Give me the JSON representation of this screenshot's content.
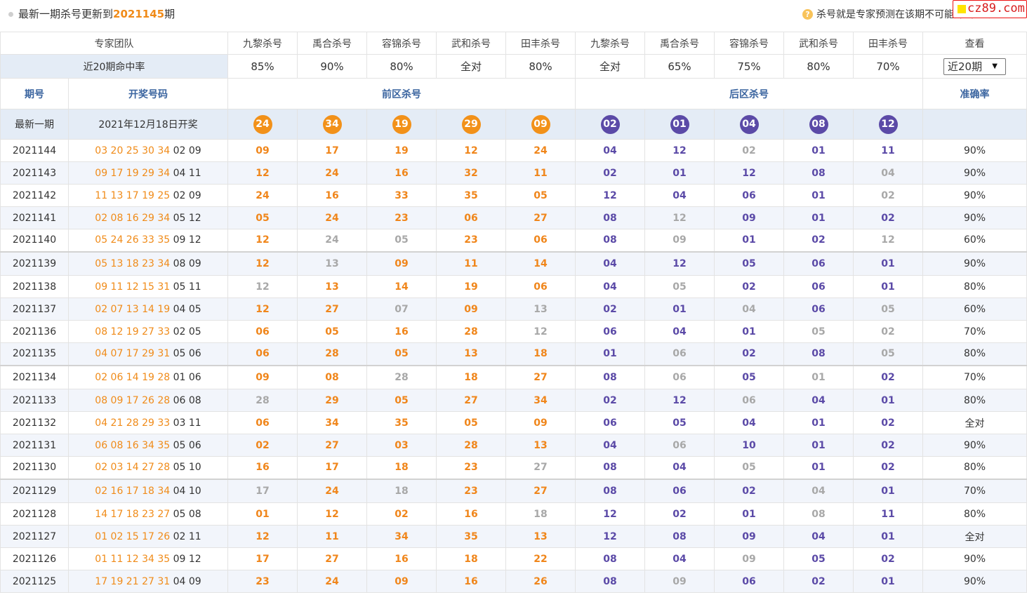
{
  "header": {
    "prefix": "最新一期杀号更新到",
    "issue": "2021145",
    "suffix": "期",
    "help_text": "杀号就是专家预测在该期不可能开出的号码",
    "logo_text": "cz89.com"
  },
  "team_row": {
    "label": "专家团队",
    "experts": [
      "九黎杀号",
      "禹合杀号",
      "容锦杀号",
      "武和杀号",
      "田丰杀号",
      "九黎杀号",
      "禹合杀号",
      "容锦杀号",
      "武和杀号",
      "田丰杀号"
    ],
    "view_label": "查看"
  },
  "rate_row": {
    "label": "近20期命中率",
    "rates": [
      "85%",
      "90%",
      "80%",
      "全对",
      "80%",
      "全对",
      "65%",
      "75%",
      "80%",
      "70%"
    ],
    "period_select": {
      "selected": "近20期",
      "arrow": "▼"
    }
  },
  "sections": {
    "issue": "期号",
    "draw": "开奖号码",
    "front": "前区杀号",
    "back": "后区杀号",
    "accuracy": "准确率"
  },
  "latest": {
    "label": "最新一期",
    "date": "2021年12月18日开奖",
    "front": [
      "24",
      "34",
      "19",
      "29",
      "09"
    ],
    "back": [
      "02",
      "01",
      "04",
      "08",
      "12"
    ]
  },
  "rows": [
    {
      "issue": "2021144",
      "draw_front": "03 20 25 30 34",
      "draw_back": "02 09",
      "front": [
        [
          "09",
          1
        ],
        [
          "17",
          1
        ],
        [
          "19",
          1
        ],
        [
          "12",
          1
        ],
        [
          "24",
          1
        ]
      ],
      "back": [
        [
          "04",
          1
        ],
        [
          "12",
          1
        ],
        [
          "02",
          0
        ],
        [
          "01",
          1
        ],
        [
          "11",
          1
        ]
      ],
      "accuracy": "90%"
    },
    {
      "issue": "2021143",
      "draw_front": "09 17 19 29 34",
      "draw_back": "04 11",
      "front": [
        [
          "12",
          1
        ],
        [
          "24",
          1
        ],
        [
          "16",
          1
        ],
        [
          "32",
          1
        ],
        [
          "11",
          1
        ]
      ],
      "back": [
        [
          "02",
          1
        ],
        [
          "01",
          1
        ],
        [
          "12",
          1
        ],
        [
          "08",
          1
        ],
        [
          "04",
          0
        ]
      ],
      "accuracy": "90%"
    },
    {
      "issue": "2021142",
      "draw_front": "11 13 17 19 25",
      "draw_back": "02 09",
      "front": [
        [
          "24",
          1
        ],
        [
          "16",
          1
        ],
        [
          "33",
          1
        ],
        [
          "35",
          1
        ],
        [
          "05",
          1
        ]
      ],
      "back": [
        [
          "12",
          1
        ],
        [
          "04",
          1
        ],
        [
          "06",
          1
        ],
        [
          "01",
          1
        ],
        [
          "02",
          0
        ]
      ],
      "accuracy": "90%"
    },
    {
      "issue": "2021141",
      "draw_front": "02 08 16 29 34",
      "draw_back": "05 12",
      "front": [
        [
          "05",
          1
        ],
        [
          "24",
          1
        ],
        [
          "23",
          1
        ],
        [
          "06",
          1
        ],
        [
          "27",
          1
        ]
      ],
      "back": [
        [
          "08",
          1
        ],
        [
          "12",
          0
        ],
        [
          "09",
          1
        ],
        [
          "01",
          1
        ],
        [
          "02",
          1
        ]
      ],
      "accuracy": "90%"
    },
    {
      "issue": "2021140",
      "draw_front": "05 24 26 33 35",
      "draw_back": "09 12",
      "front": [
        [
          "12",
          1
        ],
        [
          "24",
          0
        ],
        [
          "05",
          0
        ],
        [
          "23",
          1
        ],
        [
          "06",
          1
        ]
      ],
      "back": [
        [
          "08",
          1
        ],
        [
          "09",
          0
        ],
        [
          "01",
          1
        ],
        [
          "02",
          1
        ],
        [
          "12",
          0
        ]
      ],
      "accuracy": "60%"
    },
    {
      "issue": "2021139",
      "draw_front": "05 13 18 23 34",
      "draw_back": "08 09",
      "front": [
        [
          "12",
          1
        ],
        [
          "13",
          0
        ],
        [
          "09",
          1
        ],
        [
          "11",
          1
        ],
        [
          "14",
          1
        ]
      ],
      "back": [
        [
          "04",
          1
        ],
        [
          "12",
          1
        ],
        [
          "05",
          1
        ],
        [
          "06",
          1
        ],
        [
          "01",
          1
        ]
      ],
      "accuracy": "90%"
    },
    {
      "issue": "2021138",
      "draw_front": "09 11 12 15 31",
      "draw_back": "05 11",
      "front": [
        [
          "12",
          0
        ],
        [
          "13",
          1
        ],
        [
          "14",
          1
        ],
        [
          "19",
          1
        ],
        [
          "06",
          1
        ]
      ],
      "back": [
        [
          "04",
          1
        ],
        [
          "05",
          0
        ],
        [
          "02",
          1
        ],
        [
          "06",
          1
        ],
        [
          "01",
          1
        ]
      ],
      "accuracy": "80%"
    },
    {
      "issue": "2021137",
      "draw_front": "02 07 13 14 19",
      "draw_back": "04 05",
      "front": [
        [
          "12",
          1
        ],
        [
          "27",
          1
        ],
        [
          "07",
          0
        ],
        [
          "09",
          1
        ],
        [
          "13",
          0
        ]
      ],
      "back": [
        [
          "02",
          1
        ],
        [
          "01",
          1
        ],
        [
          "04",
          0
        ],
        [
          "06",
          1
        ],
        [
          "05",
          0
        ]
      ],
      "accuracy": "60%"
    },
    {
      "issue": "2021136",
      "draw_front": "08 12 19 27 33",
      "draw_back": "02 05",
      "front": [
        [
          "06",
          1
        ],
        [
          "05",
          1
        ],
        [
          "16",
          1
        ],
        [
          "28",
          1
        ],
        [
          "12",
          0
        ]
      ],
      "back": [
        [
          "06",
          1
        ],
        [
          "04",
          1
        ],
        [
          "01",
          1
        ],
        [
          "05",
          0
        ],
        [
          "02",
          0
        ]
      ],
      "accuracy": "70%"
    },
    {
      "issue": "2021135",
      "draw_front": "04 07 17 29 31",
      "draw_back": "05 06",
      "front": [
        [
          "06",
          1
        ],
        [
          "28",
          1
        ],
        [
          "05",
          1
        ],
        [
          "13",
          1
        ],
        [
          "18",
          1
        ]
      ],
      "back": [
        [
          "01",
          1
        ],
        [
          "06",
          0
        ],
        [
          "02",
          1
        ],
        [
          "08",
          1
        ],
        [
          "05",
          0
        ]
      ],
      "accuracy": "80%"
    },
    {
      "issue": "2021134",
      "draw_front": "02 06 14 19 28",
      "draw_back": "01 06",
      "front": [
        [
          "09",
          1
        ],
        [
          "08",
          1
        ],
        [
          "28",
          0
        ],
        [
          "18",
          1
        ],
        [
          "27",
          1
        ]
      ],
      "back": [
        [
          "08",
          1
        ],
        [
          "06",
          0
        ],
        [
          "05",
          1
        ],
        [
          "01",
          0
        ],
        [
          "02",
          1
        ]
      ],
      "accuracy": "70%"
    },
    {
      "issue": "2021133",
      "draw_front": "08 09 17 26 28",
      "draw_back": "06 08",
      "front": [
        [
          "28",
          0
        ],
        [
          "29",
          1
        ],
        [
          "05",
          1
        ],
        [
          "27",
          1
        ],
        [
          "34",
          1
        ]
      ],
      "back": [
        [
          "02",
          1
        ],
        [
          "12",
          1
        ],
        [
          "06",
          0
        ],
        [
          "04",
          1
        ],
        [
          "01",
          1
        ]
      ],
      "accuracy": "80%"
    },
    {
      "issue": "2021132",
      "draw_front": "04 21 28 29 33",
      "draw_back": "03 11",
      "front": [
        [
          "06",
          1
        ],
        [
          "34",
          1
        ],
        [
          "35",
          1
        ],
        [
          "05",
          1
        ],
        [
          "09",
          1
        ]
      ],
      "back": [
        [
          "06",
          1
        ],
        [
          "05",
          1
        ],
        [
          "04",
          1
        ],
        [
          "01",
          1
        ],
        [
          "02",
          1
        ]
      ],
      "accuracy": "全对"
    },
    {
      "issue": "2021131",
      "draw_front": "06 08 16 34 35",
      "draw_back": "05 06",
      "front": [
        [
          "02",
          1
        ],
        [
          "27",
          1
        ],
        [
          "03",
          1
        ],
        [
          "28",
          1
        ],
        [
          "13",
          1
        ]
      ],
      "back": [
        [
          "04",
          1
        ],
        [
          "06",
          0
        ],
        [
          "10",
          1
        ],
        [
          "01",
          1
        ],
        [
          "02",
          1
        ]
      ],
      "accuracy": "90%"
    },
    {
      "issue": "2021130",
      "draw_front": "02 03 14 27 28",
      "draw_back": "05 10",
      "front": [
        [
          "16",
          1
        ],
        [
          "17",
          1
        ],
        [
          "18",
          1
        ],
        [
          "23",
          1
        ],
        [
          "27",
          0
        ]
      ],
      "back": [
        [
          "08",
          1
        ],
        [
          "04",
          1
        ],
        [
          "05",
          0
        ],
        [
          "01",
          1
        ],
        [
          "02",
          1
        ]
      ],
      "accuracy": "80%"
    },
    {
      "issue": "2021129",
      "draw_front": "02 16 17 18 34",
      "draw_back": "04 10",
      "front": [
        [
          "17",
          0
        ],
        [
          "24",
          1
        ],
        [
          "18",
          0
        ],
        [
          "23",
          1
        ],
        [
          "27",
          1
        ]
      ],
      "back": [
        [
          "08",
          1
        ],
        [
          "06",
          1
        ],
        [
          "02",
          1
        ],
        [
          "04",
          0
        ],
        [
          "01",
          1
        ]
      ],
      "accuracy": "70%"
    },
    {
      "issue": "2021128",
      "draw_front": "14 17 18 23 27",
      "draw_back": "05 08",
      "front": [
        [
          "01",
          1
        ],
        [
          "12",
          1
        ],
        [
          "02",
          1
        ],
        [
          "16",
          1
        ],
        [
          "18",
          0
        ]
      ],
      "back": [
        [
          "12",
          1
        ],
        [
          "02",
          1
        ],
        [
          "01",
          1
        ],
        [
          "08",
          0
        ],
        [
          "11",
          1
        ]
      ],
      "accuracy": "80%"
    },
    {
      "issue": "2021127",
      "draw_front": "01 02 15 17 26",
      "draw_back": "02 11",
      "front": [
        [
          "12",
          1
        ],
        [
          "11",
          1
        ],
        [
          "34",
          1
        ],
        [
          "35",
          1
        ],
        [
          "13",
          1
        ]
      ],
      "back": [
        [
          "12",
          1
        ],
        [
          "08",
          1
        ],
        [
          "09",
          1
        ],
        [
          "04",
          1
        ],
        [
          "01",
          1
        ]
      ],
      "accuracy": "全对"
    },
    {
      "issue": "2021126",
      "draw_front": "01 11 12 34 35",
      "draw_back": "09 12",
      "front": [
        [
          "17",
          1
        ],
        [
          "27",
          1
        ],
        [
          "16",
          1
        ],
        [
          "18",
          1
        ],
        [
          "22",
          1
        ]
      ],
      "back": [
        [
          "08",
          1
        ],
        [
          "04",
          1
        ],
        [
          "09",
          0
        ],
        [
          "05",
          1
        ],
        [
          "02",
          1
        ]
      ],
      "accuracy": "90%"
    },
    {
      "issue": "2021125",
      "draw_front": "17 19 21 27 31",
      "draw_back": "04 09",
      "front": [
        [
          "23",
          1
        ],
        [
          "24",
          1
        ],
        [
          "09",
          1
        ],
        [
          "16",
          1
        ],
        [
          "26",
          1
        ]
      ],
      "back": [
        [
          "08",
          1
        ],
        [
          "09",
          0
        ],
        [
          "06",
          1
        ],
        [
          "02",
          1
        ],
        [
          "01",
          1
        ]
      ],
      "accuracy": "90%"
    }
  ]
}
